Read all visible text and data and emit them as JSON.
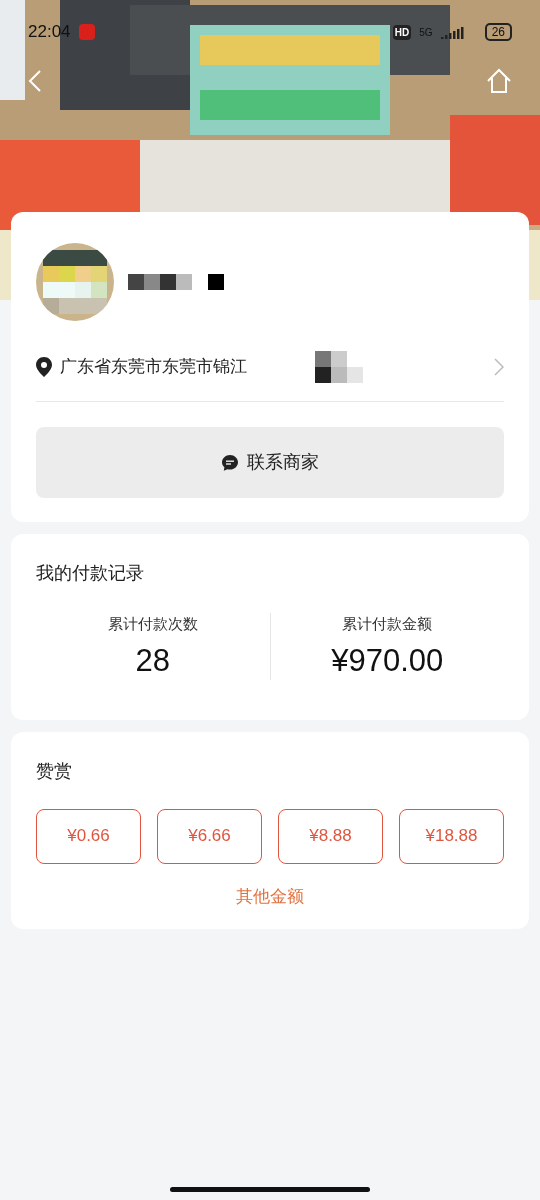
{
  "status_bar": {
    "time": "22:04",
    "network": "5G",
    "hd": "HD",
    "battery": "26"
  },
  "merchant": {
    "address": "广东省东莞市东莞市锦江",
    "contact_button": "联系商家"
  },
  "payment_record": {
    "title": "我的付款记录",
    "stats": [
      {
        "label": "累计付款次数",
        "value": "28"
      },
      {
        "label": "累计付款金额",
        "value": "¥970.00"
      }
    ]
  },
  "tip": {
    "title": "赞赏",
    "amounts": [
      "¥0.66",
      "¥6.66",
      "¥8.88",
      "¥18.88"
    ],
    "other": "其他金额"
  }
}
